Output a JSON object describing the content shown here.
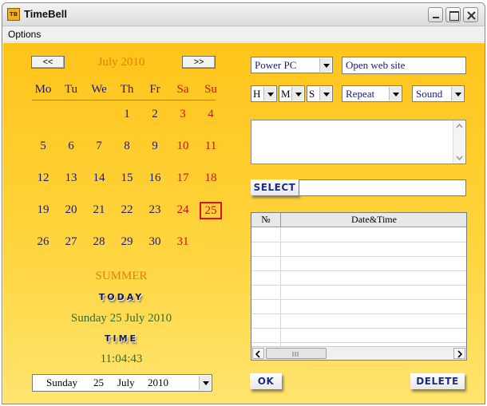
{
  "window": {
    "title": "TimeBell",
    "icon": "app-icon",
    "icon_text": "TB"
  },
  "menu": {
    "options_label": "Options"
  },
  "calendar": {
    "prev_label": "<<",
    "next_label": ">>",
    "month_label": "July 2010",
    "weekdays": [
      "Mo",
      "Tu",
      "We",
      "Th",
      "Fr",
      "Sa",
      "Su"
    ],
    "weeks": [
      [
        "",
        "",
        "",
        "1",
        "2",
        "3",
        "4"
      ],
      [
        "5",
        "6",
        "7",
        "8",
        "9",
        "10",
        "11"
      ],
      [
        "12",
        "13",
        "14",
        "15",
        "16",
        "17",
        "18"
      ],
      [
        "19",
        "20",
        "21",
        "22",
        "23",
        "24",
        "25"
      ],
      [
        "26",
        "27",
        "28",
        "29",
        "30",
        "31",
        ""
      ]
    ],
    "selected_day": "25",
    "weekday_color": "#1a1a7a",
    "weekend_color": "#d01010"
  },
  "season": "SUMMER",
  "today_label": "TODAY",
  "today_date": "Sunday 25 July 2010",
  "time_label": "TIME",
  "current_time": "11:04:43",
  "date_picker": {
    "weekday": "Sunday",
    "day": "25",
    "month": "July",
    "year": "2010"
  },
  "controls": {
    "action_combo": "Power PC",
    "action_text": "Open web site",
    "hour": "H",
    "minute": "M",
    "second": "S",
    "repeat": "Repeat",
    "sound": "Sound",
    "select_label": "SELECT",
    "select_value": "",
    "ok_label": "OK",
    "delete_label": "DELETE"
  },
  "schedule": {
    "columns": [
      "№",
      "Date&Time"
    ],
    "rows": []
  },
  "colors": {
    "accent": "#ffc41a",
    "navy": "#1a1a7a",
    "orange": "#e08000",
    "green": "#3a6a2a"
  }
}
